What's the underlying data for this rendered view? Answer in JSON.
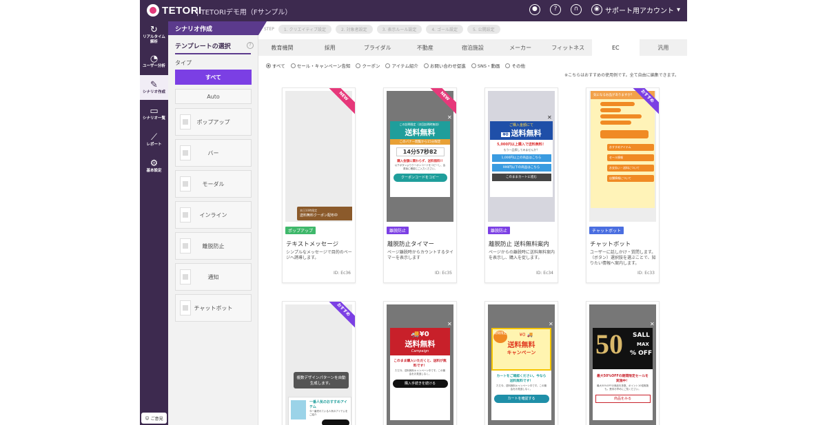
{
  "app": {
    "logo": "TETORI",
    "title": "TETORIデモ用（Fサンプル）",
    "account": "サポート用アカウント"
  },
  "nav": [
    {
      "label": "リアルタイム\n解析",
      "icon": "↻"
    },
    {
      "label": "ユーザー分析",
      "icon": "◔"
    },
    {
      "label": "シナリオ作成",
      "icon": "✎"
    },
    {
      "label": "シナリオ一覧",
      "icon": "▭"
    },
    {
      "label": "レポート",
      "icon": "⟋"
    },
    {
      "label": "基本設定",
      "icon": "⚙"
    }
  ],
  "help": "ご意見",
  "scenario": {
    "heading": "シナリオ作成",
    "step_label": "STEP"
  },
  "steps": [
    "1. クリエイティブ設定",
    "2. 対象者設定",
    "3. 表示ルール設定",
    "4. ゴール設定",
    "5. 公開設定"
  ],
  "side": {
    "title": "テンプレートの選択",
    "help": "?",
    "type_label": "タイプ",
    "types": [
      "すべて",
      "Auto",
      "ポップアップ",
      "バー",
      "モーダル",
      "インライン",
      "離脱防止",
      "通知",
      "チャットボット"
    ]
  },
  "tabs": [
    "教育機関",
    "採用",
    "ブライダル",
    "不動産",
    "宿泊施設",
    "メーカー",
    "フィットネス",
    "EC",
    "汎用"
  ],
  "active_tab": "EC",
  "filters": [
    "すべて",
    "セール・キャンペーン告知",
    "クーポン",
    "アイテム紹介",
    "お問い合わせ促進",
    "SNS・動画",
    "その他"
  ],
  "note": "※こちらはおすすめの使用例です。全て自由に編集できます。",
  "cards": [
    {
      "ribbon": "NEW",
      "badge": "ポップアップ",
      "badge_color": "#3fb86b",
      "name": "テキストメッセージ",
      "desc": "シンプルなメッセージで目的のページへ誘導します。",
      "id": "ID: Ec36",
      "preview": {
        "banner": "送料無料クーポン配布中",
        "sub": "本日10時限定"
      }
    },
    {
      "ribbon": "NEW",
      "badge": "離脱防止",
      "badge_color": "#7b3fe4",
      "name": "離脱防止タイマー",
      "desc": "ページ離脱時からカウントするタイマーを表示します",
      "id": "ID: Ec35",
      "preview": {
        "top": "この訪問限定（次回訪問時無効）",
        "big": "送料無料",
        "limit": "このバナー閲覧から15分限定",
        "timer": "14分57秒82",
        "msg": "購入金額に関わらず、送料無料!!",
        "small": "以下ボタンよりクーポンコードをコピーし、会員後に確認にご入力ください。",
        "btn": "クーポンコードをコピー"
      }
    },
    {
      "ribbon": "",
      "badge": "離脱防止",
      "badge_color": "#7b3fe4",
      "name": "離脱防止 送料無料案内",
      "desc": "ページからの離脱時に送料無料案内を表示し、購入を促します。",
      "id": "ID: Ec34",
      "preview": {
        "top": "ご購入金額にて",
        "big": "送料無料",
        "msg": "5,000円以上購入で送料無料！",
        "sub": "もう一品探してみませんか？",
        "b1": "1,000円以上の商品はこちら",
        "b2": "999円以下の商品はこちら",
        "b3": "このままカートに進む"
      }
    },
    {
      "ribbon": "おすすめ",
      "badge": "チャットボット",
      "badge_color": "#4a6ee0",
      "name": "チャットボット",
      "desc": "ユーザーに話しかけ・質問します。（ボタン）選択肢を選ぶことで、知りたい情報へ案内します。",
      "id": "ID: Ec33",
      "preview": {
        "head": "気になるお品がありますか？",
        "b1": "おすすめアイテム",
        "b2": "セール情報",
        "b3": "お支払い・送料について",
        "b4": "店舗情報について"
      }
    },
    {
      "ribbon": "おすすめ",
      "badge": "",
      "badge_color": "",
      "name": "",
      "desc": "",
      "id": "",
      "preview": {
        "bubble": "複数デザインパターンを自動生成します。",
        "title": "一番人気のおすすめアイテム",
        "sub": "今一番売れている人気のアイテムをご紹介"
      }
    },
    {
      "ribbon": "",
      "badge": "",
      "badge_color": "",
      "name": "",
      "desc": "",
      "id": "",
      "preview": {
        "big": "送料無料",
        "sub": "Campaign",
        "msg": "このまま購入いただくと、送料が無料です！",
        "small": "ただ今、送料無料キャンペーン中です。この機会をお見逃しなく。",
        "btn": "購入手続きを続ける"
      }
    },
    {
      "ribbon": "",
      "badge": "",
      "badge_color": "",
      "name": "",
      "desc": "",
      "id": "",
      "preview": {
        "tag": "期間限定",
        "big": "送料無料",
        "sub": "キャンペーン",
        "msg": "カートをご確認ください。今なら送料無料です！",
        "small": "ただ今、送料無料キャンペーン中です。この機会をお見逃しなく。",
        "btn": "カートを確認する"
      }
    },
    {
      "ribbon": "",
      "badge": "",
      "badge_color": "",
      "name": "",
      "desc": "",
      "id": "",
      "preview": {
        "num": "50",
        "sale": "SALL",
        "max": "MAX",
        "off": "% OFF",
        "msg": "最大50%OFFの期間限定セールを実施中！",
        "small": "最大50%OFFの商品を多数。ポイント10倍実施も。是非お早めにご覧ください。",
        "btn": "商品をみる"
      }
    }
  ]
}
